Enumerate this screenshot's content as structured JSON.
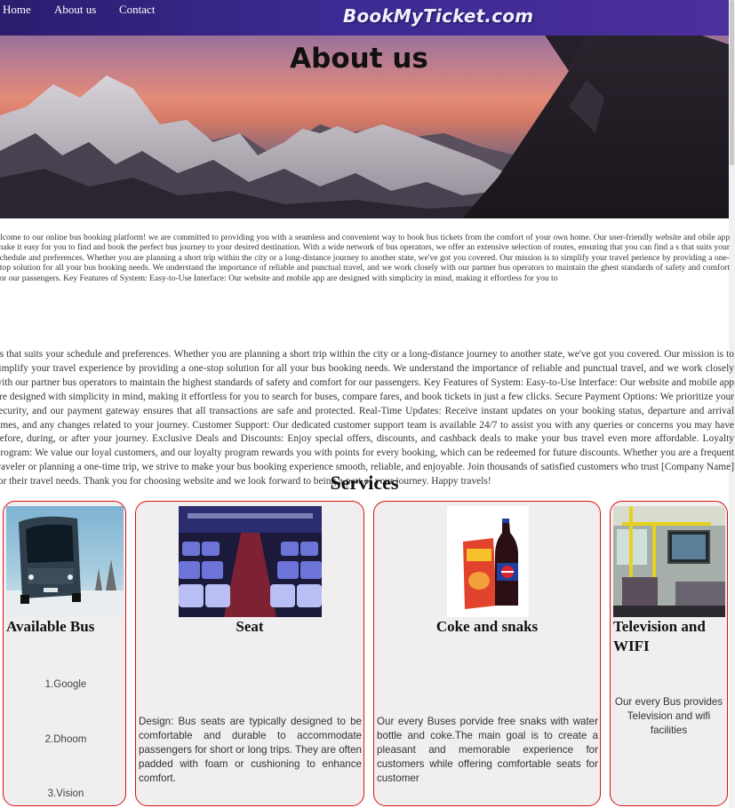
{
  "nav": {
    "items": [
      "Home",
      "About us",
      "Contact"
    ],
    "brand": "BookMyTicket.com"
  },
  "hero": {
    "title": "About us"
  },
  "marquee_text": "elcome to our online bus booking platform! we are committed to providing you with a seamless and convenient way to book bus tickets from the comfort of your own home. Our user-friendly website and obile app make it easy for you to find and book the perfect bus journey to your desired destination. With a wide network of bus operators, we offer an extensive selection of routes, ensuring that you can find a s that suits your schedule and preferences. Whether you are planning a short trip within the city or a long-distance journey to another state, we've got you covered. Our mission is to simplify your travel perience by providing a one-stop solution for all your bus booking needs. We understand the importance of reliable and punctual travel, and we work closely with our partner bus operators to maintain the ghest standards of safety and comfort for our passengers. Key Features of System: Easy-to-Use Interface: Our website and mobile app are designed with simplicity in mind, making it effortless for you to",
  "about_text": "us that suits your schedule and preferences. Whether you are planning a short trip within the city or a long-distance journey to another state, we've got you covered. Our mission is to simplify your travel experience by providing a one-stop solution for all your bus booking needs. We understand the importance of reliable and punctual travel, and we work closely with our partner bus operators to maintain the highest standards of safety and comfort for our passengers. Key Features of System: Easy-to-Use Interface: Our website and mobile app are designed with simplicity in mind, making it effortless for you to search for buses, compare fares, and book tickets in just a few clicks. Secure Payment Options: We prioritize your security, and our payment gateway ensures that all transactions are safe and protected. Real-Time Updates: Receive instant updates on your booking status, departure and arrival times, and any changes related to your journey. Customer Support: Our dedicated customer support team is available 24/7 to assist you with any queries or concerns you may have before, during, or after your journey. Exclusive Deals and Discounts: Enjoy special offers, discounts, and cashback deals to make your bus travel even more affordable. Loyalty Program: We value our loyal customers, and our loyalty program rewards you with points for every booking, which can be redeemed for future discounts. Whether you are a frequent traveler or planning a one-time trip, we strive to make your bus booking experience smooth, reliable, and enjoyable. Join thousands of satisfied customers who trust [Company Name] for their travel needs. Thank you for choosing website and we look forward to being a part of your journey. Happy travels!",
  "services": {
    "title": "Services",
    "cards": [
      {
        "title": "Available Bus",
        "links": [
          "1.Google",
          "2.Dhoom",
          "3.Vision"
        ]
      },
      {
        "title": "Seat",
        "desc": "Design: Bus seats are typically designed to be comfortable and durable to accommodate passengers for short or long trips. They are often padded with foam or cushioning to enhance comfort."
      },
      {
        "title": "Coke and snaks",
        "desc": "Our every Buses porvide free snaks with water bottle and coke.The main goal is to create a pleasant and memorable experience for customers while offering comfortable seats for customer"
      },
      {
        "title": "Television and WIFI",
        "desc": "Our every Bus provides Television and wifi facilities"
      }
    ]
  }
}
